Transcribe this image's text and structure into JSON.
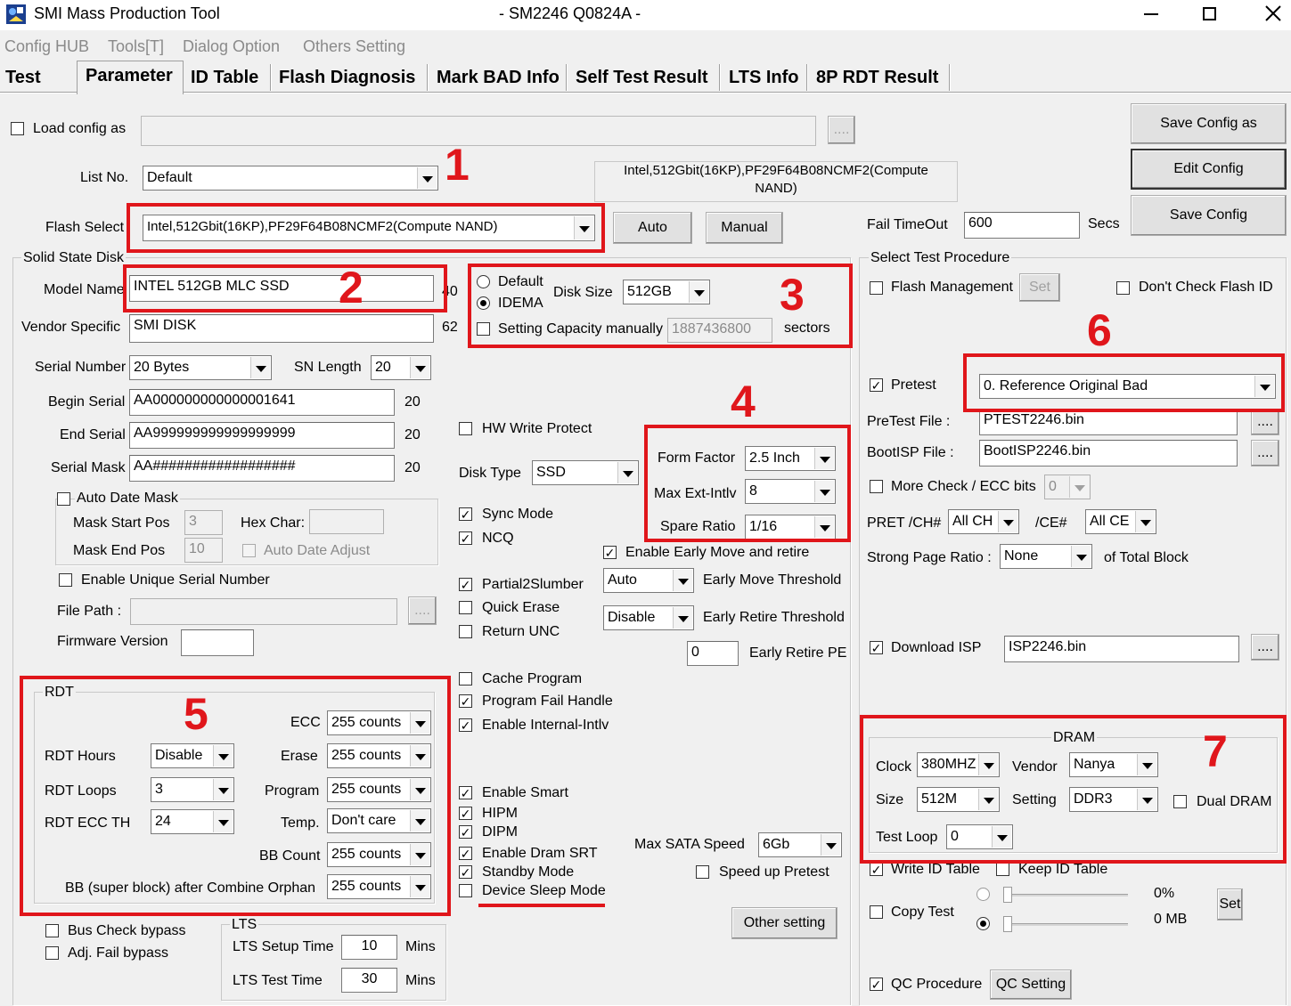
{
  "window": {
    "title": "SMI Mass Production Tool",
    "subtitle": "- SM2246 Q0824A -",
    "min_icon": "minimize-icon",
    "max_icon": "maximize-icon",
    "close_icon": "close-icon"
  },
  "menu": [
    "Config HUB",
    "Tools[T]",
    "Dialog Option",
    "Others Setting"
  ],
  "tabs": [
    "Test",
    "Parameter",
    "ID Table",
    "Flash Diagnosis",
    "Mark BAD Info",
    "Self Test Result",
    "LTS Info",
    "8P RDT Result"
  ],
  "top": {
    "load_config_label": "Load config as",
    "load_config_value": "",
    "browse": "....",
    "save_config_as": "Save Config as",
    "edit_config": "Edit Config",
    "save_config": "Save Config",
    "list_no_label": "List No.",
    "list_no_value": "Default",
    "flash_info_line1": "Intel,512Gbit(16KP),PF29F64B08NCMF2(Compute",
    "flash_info_line2": "NAND)",
    "flash_select_label": "Flash Select",
    "flash_select_value": "Intel,512Gbit(16KP),PF29F64B08NCMF2(Compute NAND)",
    "auto": "Auto",
    "manual": "Manual",
    "fail_timeout_label": "Fail TimeOut",
    "fail_timeout_value": "600",
    "secs": "Secs"
  },
  "ssd": {
    "group_title": "Solid State Disk",
    "model_name_label": "Model Name",
    "model_name_value": "INTEL 512GB MLC SSD",
    "model_name_len": "40",
    "vendor_label": "Vendor Specific",
    "vendor_value": "SMI DISK",
    "vendor_len": "62",
    "serial_number_label": "Serial Number",
    "serial_number_value": "20 Bytes",
    "sn_length_label": "SN Length",
    "sn_length_value": "20",
    "begin_serial_label": "Begin Serial",
    "begin_serial_value": "AA000000000000001641",
    "begin_serial_len": "20",
    "end_serial_label": "End Serial",
    "end_serial_value": "AA999999999999999999",
    "end_serial_len": "20",
    "serial_mask_label": "Serial Mask",
    "serial_mask_value": "AA##################",
    "serial_mask_len": "20",
    "auto_date_mask": "Auto Date Mask",
    "mask_start_label": "Mask Start Pos",
    "mask_start_value": "3",
    "hex_char_label": "Hex Char:",
    "mask_end_label": "Mask End Pos",
    "mask_end_value": "10",
    "auto_date_adjust": "Auto Date Adjust",
    "enable_unique": "Enable Unique Serial Number",
    "file_path_label": "File Path :",
    "firmware_label": "Firmware Version"
  },
  "disk": {
    "default": "Default",
    "idema": "IDEMA",
    "disk_size_label": "Disk Size",
    "disk_size_value": "512GB",
    "setting_capacity": "Setting Capacity manually",
    "capacity_value": "1887436800",
    "sectors": "sectors",
    "hw_write_protect": "HW Write Protect",
    "disk_type_label": "Disk Type",
    "disk_type_value": "SSD",
    "form_factor_label": "Form Factor",
    "form_factor_value": "2.5 Inch",
    "max_ext_label": "Max Ext-Intlv",
    "max_ext_value": "8",
    "spare_ratio_label": "Spare Ratio",
    "spare_ratio_value": "1/16",
    "sync_mode": "Sync Mode",
    "ncq": "NCQ",
    "enable_early": "Enable Early Move and retire",
    "partial2slumber": "Partial2Slumber",
    "quick_erase": "Quick Erase",
    "return_unc": "Return UNC",
    "early_move_value": "Auto",
    "early_move_label": "Early Move Threshold",
    "early_retire_value": "Disable",
    "early_retire_label": "Early Retire Threshold",
    "early_retire_pe_value": "0",
    "early_retire_pe_label": "Early Retire PE",
    "cache_program": "Cache Program",
    "program_fail": "Program Fail Handle",
    "enable_internal": "Enable Internal-Intlv",
    "enable_smart": "Enable Smart",
    "hipm": "HIPM",
    "dipm": "DIPM",
    "enable_dram_srt": "Enable Dram SRT",
    "standby_mode": "Standby Mode",
    "device_sleep": "Device Sleep Mode",
    "max_sata_label": "Max SATA Speed",
    "max_sata_value": "6Gb",
    "speed_up_pretest": "Speed up Pretest",
    "other_setting": "Other setting"
  },
  "rdt": {
    "title": "RDT",
    "ecc_label": "ECC",
    "ecc_value": "255 counts",
    "hours_label": "RDT Hours",
    "hours_value": "Disable",
    "erase_label": "Erase",
    "erase_value": "255 counts",
    "loops_label": "RDT Loops",
    "loops_value": "3",
    "program_label": "Program",
    "program_value": "255 counts",
    "ecc_th_label": "RDT ECC TH",
    "ecc_th_value": "24",
    "temp_label": "Temp.",
    "temp_value": "Don't care",
    "bb_count_label": "BB Count",
    "bb_count_value": "255 counts",
    "bb_super_label": "BB (super block) after Combine Orphan",
    "bb_super_value": "255 counts"
  },
  "bottom_left": {
    "bus_check": "Bus Check bypass",
    "adj_fail": "Adj. Fail bypass",
    "lts_title": "LTS",
    "lts_setup_label": "LTS Setup Time",
    "lts_setup_value": "10",
    "lts_test_label": "LTS Test Time",
    "lts_test_value": "30",
    "mins": "Mins"
  },
  "procedure": {
    "title": "Select Test Procedure",
    "flash_mgmt": "Flash Management",
    "set": "Set",
    "dont_check": "Don't Check Flash ID",
    "pretest": "Pretest",
    "pretest_value": "0. Reference Original Bad",
    "pretest_file_label": "PreTest File :",
    "pretest_file_value": "PTEST2246.bin",
    "bootisp_label": "BootISP File :",
    "bootisp_value": "BootISP2246.bin",
    "more_check": "More Check / ECC bits",
    "more_check_value": "0",
    "pret_ch_label": "PRET /CH#",
    "pret_ch_value": "All CH",
    "ce_label": "/CE#",
    "ce_value": "All CE",
    "strong_page_label": "Strong Page Ratio :",
    "strong_page_value": "None",
    "of_total": "of Total Block",
    "download_isp": "Download ISP",
    "isp_value": "ISP2246.bin",
    "dram_title": "DRAM",
    "clock_label": "Clock",
    "clock_value": "380MHZ",
    "vendor_label": "Vendor",
    "vendor_value": "Nanya",
    "size_label": "Size",
    "size_value": "512M",
    "setting_label": "Setting",
    "setting_value": "DDR3",
    "dual_dram": "Dual DRAM",
    "test_loop_label": "Test Loop",
    "test_loop_value": "0",
    "write_id_table": "Write ID Table",
    "keep_id_table": "Keep ID Table",
    "copy_test": "Copy Test",
    "pct": "0%",
    "mb": "0 MB",
    "set2": "Set",
    "qc_procedure": "QC Procedure",
    "qc_setting": "QC Setting"
  },
  "annotations": [
    "1",
    "2",
    "3",
    "4",
    "5",
    "6",
    "7"
  ],
  "colors": {
    "annotation": "#e0161b",
    "window_bg": "#f0f0f0"
  }
}
